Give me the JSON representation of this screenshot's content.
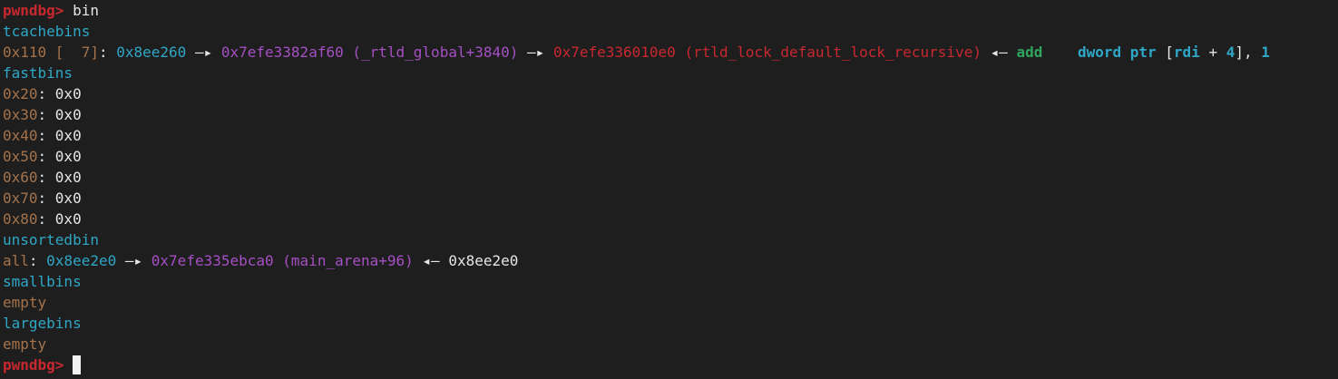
{
  "prompt": "pwndbg>",
  "command": "bin",
  "tcache": {
    "header": "tcachebins",
    "size": "0x110",
    "count_open": " [  7]",
    "count_close": ":",
    "addr1": "0x8ee260",
    "arrow1": "—▸",
    "addr2": "0x7efe3382af60",
    "sym2": "(_rtld_global+3840)",
    "arrow2": "—▸",
    "addr3": "0x7efe336010e0",
    "sym3": "(rtld_lock_default_lock_recursive)",
    "arrow3": "◂—",
    "mnemonic": "add",
    "operands_kw": "dword ptr",
    "bracket_open": "[",
    "reg": "rdi",
    "plus": " + ",
    "offset": "4",
    "bracket_close": "],",
    "imm": "1"
  },
  "fastbins": {
    "header": "fastbins",
    "rows": [
      {
        "size": "0x20",
        "value": "0x0"
      },
      {
        "size": "0x30",
        "value": "0x0"
      },
      {
        "size": "0x40",
        "value": "0x0"
      },
      {
        "size": "0x50",
        "value": "0x0"
      },
      {
        "size": "0x60",
        "value": "0x0"
      },
      {
        "size": "0x70",
        "value": "0x0"
      },
      {
        "size": "0x80",
        "value": "0x0"
      }
    ]
  },
  "unsortedbin": {
    "header": "unsortedbin",
    "label": "all",
    "addr1": "0x8ee2e0",
    "arrow1": "—▸",
    "addr2": "0x7efe335ebca0",
    "sym2": "(main_arena+96)",
    "arrow2": "◂—",
    "addr3": "0x8ee2e0"
  },
  "smallbins": {
    "header": "smallbins",
    "status": "empty"
  },
  "largebins": {
    "header": "largebins",
    "status": "empty"
  },
  "colors": {
    "background": "#1e1e1e",
    "prompt": "#c8282f",
    "header": "#2fa7c6",
    "size": "#a5734b",
    "heap_addr": "#2fa7c6",
    "libc_addr": "#a64fc4",
    "code_addr": "#c8282f",
    "mnemonic": "#2fa55d"
  }
}
